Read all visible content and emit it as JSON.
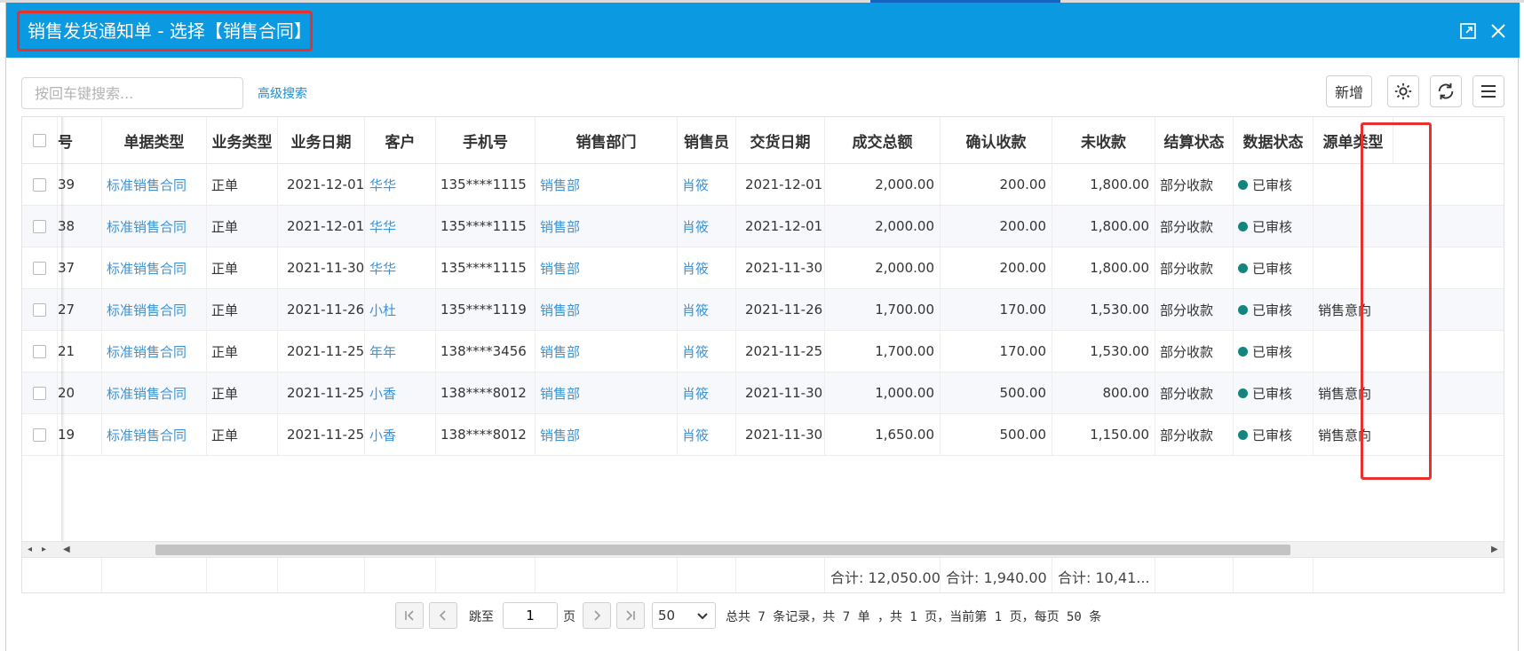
{
  "window": {
    "title": "销售发货通知单 - 选择【销售合同】"
  },
  "toolbar": {
    "search_placeholder": "按回车键搜索...",
    "advanced_search": "高级搜索",
    "new_button": "新增"
  },
  "table": {
    "columns": [
      "号",
      "单据类型",
      "业务类型",
      "业务日期",
      "客户",
      "手机号",
      "销售部门",
      "销售员",
      "交货日期",
      "成交总额",
      "确认收款",
      "未收款",
      "结算状态",
      "数据状态",
      "源单类型"
    ],
    "rows": [
      {
        "no": "39",
        "doc_type": "标准销售合同",
        "biz_type": "正单",
        "biz_date": "2021-12-01",
        "customer": "华华",
        "phone": "135****1115",
        "dept": "销售部",
        "salesman": "肖筱",
        "delivery_date": "2021-12-01",
        "total": "2,000.00",
        "received": "200.00",
        "unpaid": "1,800.00",
        "settle": "部分收款",
        "status": "已审核",
        "source": ""
      },
      {
        "no": "38",
        "doc_type": "标准销售合同",
        "biz_type": "正单",
        "biz_date": "2021-12-01",
        "customer": "华华",
        "phone": "135****1115",
        "dept": "销售部",
        "salesman": "肖筱",
        "delivery_date": "2021-12-01",
        "total": "2,000.00",
        "received": "200.00",
        "unpaid": "1,800.00",
        "settle": "部分收款",
        "status": "已审核",
        "source": ""
      },
      {
        "no": "37",
        "doc_type": "标准销售合同",
        "biz_type": "正单",
        "biz_date": "2021-11-30",
        "customer": "华华",
        "phone": "135****1115",
        "dept": "销售部",
        "salesman": "肖筱",
        "delivery_date": "2021-11-30",
        "total": "2,000.00",
        "received": "200.00",
        "unpaid": "1,800.00",
        "settle": "部分收款",
        "status": "已审核",
        "source": ""
      },
      {
        "no": "27",
        "doc_type": "标准销售合同",
        "biz_type": "正单",
        "biz_date": "2021-11-26",
        "customer": "小杜",
        "phone": "135****1119",
        "dept": "销售部",
        "salesman": "肖筱",
        "delivery_date": "2021-11-26",
        "total": "1,700.00",
        "received": "170.00",
        "unpaid": "1,530.00",
        "settle": "部分收款",
        "status": "已审核",
        "source": "销售意向"
      },
      {
        "no": "21",
        "doc_type": "标准销售合同",
        "biz_type": "正单",
        "biz_date": "2021-11-25",
        "customer": "年年",
        "phone": "138****3456",
        "dept": "销售部",
        "salesman": "肖筱",
        "delivery_date": "2021-11-25",
        "total": "1,700.00",
        "received": "170.00",
        "unpaid": "1,530.00",
        "settle": "部分收款",
        "status": "已审核",
        "source": ""
      },
      {
        "no": "20",
        "doc_type": "标准销售合同",
        "biz_type": "正单",
        "biz_date": "2021-11-25",
        "customer": "小香",
        "phone": "138****8012",
        "dept": "销售部",
        "salesman": "肖筱",
        "delivery_date": "2021-11-30",
        "total": "1,000.00",
        "received": "500.00",
        "unpaid": "800.00",
        "settle": "部分收款",
        "status": "已审核",
        "source": "销售意向"
      },
      {
        "no": "19",
        "doc_type": "标准销售合同",
        "biz_type": "正单",
        "biz_date": "2021-11-25",
        "customer": "小香",
        "phone": "138****8012",
        "dept": "销售部",
        "salesman": "肖筱",
        "delivery_date": "2021-11-30",
        "total": "1,650.00",
        "received": "500.00",
        "unpaid": "1,150.00",
        "settle": "部分收款",
        "status": "已审核",
        "source": "销售意向"
      }
    ],
    "footer": {
      "total": "合计: 12,050.00",
      "received": "合计: 1,940.00",
      "unpaid": "合计: 10,41..."
    }
  },
  "colors": {
    "titlebar": "#0b9ae2",
    "highlight": "#e5322d",
    "link": "#3c93d6",
    "status_dot": "#13857e"
  },
  "pager": {
    "jump_label": "跳至",
    "page_value": "1",
    "page_unit": "页",
    "page_size": "50",
    "summary": "总共 7 条记录，共 7 单 ，共 1 页，当前第 1 页，每页 50 条"
  }
}
